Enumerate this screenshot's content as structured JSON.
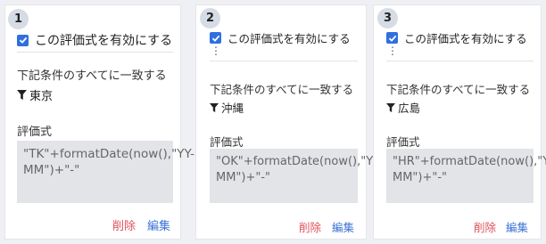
{
  "cards": [
    {
      "number": "1",
      "enable_label": "この評価式を有効にする",
      "condition_heading": "下記条件のすべてに一致する",
      "filter_value": "東京",
      "expression_label": "評価式",
      "expression": "\"TK\"+formatDate(now(),\"YY-MM\")+\"-\"",
      "delete_label": "削除",
      "edit_label": "編集"
    },
    {
      "number": "2",
      "enable_label": "この評価式を有効にする",
      "condition_heading": "下記条件のすべてに一致する",
      "filter_value": "沖縄",
      "expression_label": "評価式",
      "expression": "\"OK\"+formatDate(now(),\"YY-MM\")+\"-\"",
      "delete_label": "削除",
      "edit_label": "編集"
    },
    {
      "number": "3",
      "enable_label": "この評価式を有効にする",
      "condition_heading": "下記条件のすべてに一致する",
      "filter_value": "広島",
      "expression_label": "評価式",
      "expression": "\"HR\"+formatDate(now(),\"YY-MM\")+\"-\"",
      "delete_label": "削除",
      "edit_label": "編集"
    }
  ],
  "colors": {
    "checkbox": "#2f6fe0",
    "delete": "#e0505a",
    "edit": "#3a72d6",
    "expression_bg": "#e2e4e8"
  },
  "icons": {
    "checkbox": "check-icon",
    "more": "vertical-dots-icon",
    "filter": "funnel-icon"
  }
}
